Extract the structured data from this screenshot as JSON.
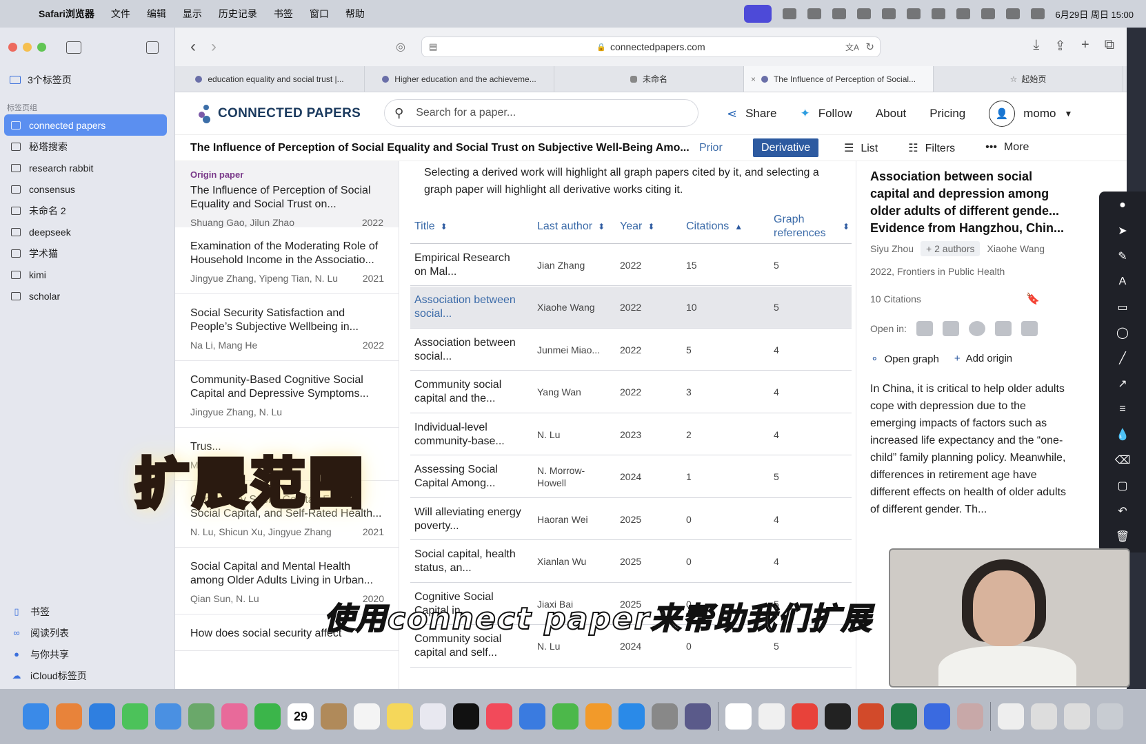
{
  "menubar": {
    "app_name": "Safari浏览器",
    "items": [
      "文件",
      "编辑",
      "显示",
      "历史记录",
      "书签",
      "窗口",
      "帮助"
    ],
    "datetime": "6月29日 周日 15:00"
  },
  "sidebar": {
    "tab_groups": "3个标签页",
    "section_header": "标签页组",
    "items": [
      {
        "label": "connected papers",
        "active": true
      },
      {
        "label": "秘塔搜索"
      },
      {
        "label": "research rabbit"
      },
      {
        "label": "consensus"
      },
      {
        "label": "未命名 2"
      },
      {
        "label": "deepseek"
      },
      {
        "label": "学术猫"
      },
      {
        "label": "kimi"
      },
      {
        "label": "scholar"
      }
    ],
    "bottom": [
      "书签",
      "阅读列表",
      "与你共享",
      "iCloud标签页"
    ]
  },
  "browser": {
    "url": "connectedpapers.com",
    "tabs": [
      "education equality and social trust |...",
      "Higher education and the achieveme...",
      "未命名",
      "The Influence of Perception of Social...",
      "起始页"
    ]
  },
  "cp": {
    "logo": "CONNECTED PAPERS",
    "search_placeholder": "Search for a paper...",
    "share": "Share",
    "follow": "Follow",
    "about": "About",
    "pricing": "Pricing",
    "user": "momo",
    "graph_title": "The Influence of Perception of Social Equality and Social Trust on Subjective Well-Being Amo...",
    "prior": "Prior",
    "derivative": "Derivative",
    "list": "List",
    "filters": "Filters",
    "more": "More"
  },
  "left_panel": {
    "origin_label": "Origin paper",
    "origin": {
      "title": "The Influence of Perception of Social Equality and Social Trust on...",
      "authors": "Shuang Gao, Jilun Zhao",
      "year": "2022"
    },
    "papers": [
      {
        "title": "Examination of the Moderating Role of Household Income in the Associatio...",
        "authors": "Jingyue Zhang, Yipeng Tian, N. Lu",
        "year": "2021"
      },
      {
        "title": "Social Security Satisfaction and People’s Subjective Wellbeing in...",
        "authors": "Na Li, Mang He",
        "year": "2022"
      },
      {
        "title": "Community-Based Cognitive Social Capital and Depressive Symptoms...",
        "authors": "Jingyue Zhang, N. Lu",
        "year": ""
      },
      {
        "title": "Trus...",
        "authors": "Ma...",
        "year": ""
      },
      {
        "title": "Community Social Capital, Family Social Capital, and Self-Rated Health...",
        "authors": "N. Lu, Shicun Xu, Jingyue Zhang",
        "year": "2021"
      },
      {
        "title": "Social Capital and Mental Health among Older Adults Living in Urban...",
        "authors": "Qian Sun, N. Lu",
        "year": "2020"
      },
      {
        "title": "How does social security affect",
        "authors": "",
        "year": ""
      }
    ]
  },
  "table": {
    "intro": "Selecting a derived work will highlight all graph papers cited by it, and selecting a graph paper will highlight all derivative works citing it.",
    "headers": {
      "title": "Title",
      "last_author": "Last author",
      "year": "Year",
      "citations": "Citations",
      "graph_refs": "Graph references"
    },
    "rows": [
      {
        "title": "Empirical Research on Mal...",
        "author": "Jian Zhang",
        "year": "2022",
        "citations": "15",
        "refs": "5"
      },
      {
        "title": "Association between social...",
        "author": "Xiaohe Wang",
        "year": "2022",
        "citations": "10",
        "refs": "5",
        "highlight": true
      },
      {
        "title": "Association between social...",
        "author": "Junmei Miao...",
        "year": "2022",
        "citations": "5",
        "refs": "4"
      },
      {
        "title": "Community social capital and the...",
        "author": "Yang Wan",
        "year": "2022",
        "citations": "3",
        "refs": "4"
      },
      {
        "title": "Individual-level community-base...",
        "author": "N. Lu",
        "year": "2023",
        "citations": "2",
        "refs": "4"
      },
      {
        "title": "Assessing Social Capital Among...",
        "author": "N. Morrow-Howell",
        "year": "2024",
        "citations": "1",
        "refs": "5"
      },
      {
        "title": "Will alleviating energy poverty...",
        "author": "Haoran Wei",
        "year": "2025",
        "citations": "0",
        "refs": "4"
      },
      {
        "title": "Social capital, health status, an...",
        "author": "Xianlan Wu",
        "year": "2025",
        "citations": "0",
        "refs": "4"
      },
      {
        "title": "Cognitive Social Capital in...",
        "author": "Jiaxi Bai",
        "year": "2025",
        "citations": "0",
        "refs": "5"
      },
      {
        "title": "Community social capital and self...",
        "author": "N. Lu",
        "year": "2024",
        "citations": "0",
        "refs": "5"
      }
    ]
  },
  "right_panel": {
    "title": "Association between social capital and depression among older adults of different gende... Evidence from Hangzhou, Chin...",
    "author1": "Siyu Zhou",
    "more_authors": "+ 2 authors",
    "author2": "Xiaohe Wang",
    "venue": "2022, Frontiers in Public Health",
    "citations": "10 Citations",
    "open_in": "Open in:",
    "open_graph": "Open graph",
    "add_origin": "Add origin",
    "abstract": "In China, it is critical to help older adults cope with depression due to the emerging impacts of factors such as increased life expectancy and the “one-child” family planning policy. Meanwhile, differences in retirement age have different effects on health of older adults of different gender. Th..."
  },
  "overlay": {
    "sticker": "扩展范围",
    "caption": "使用connect paper来帮助我们扩展"
  },
  "dock": {
    "calendar_day": "29"
  }
}
